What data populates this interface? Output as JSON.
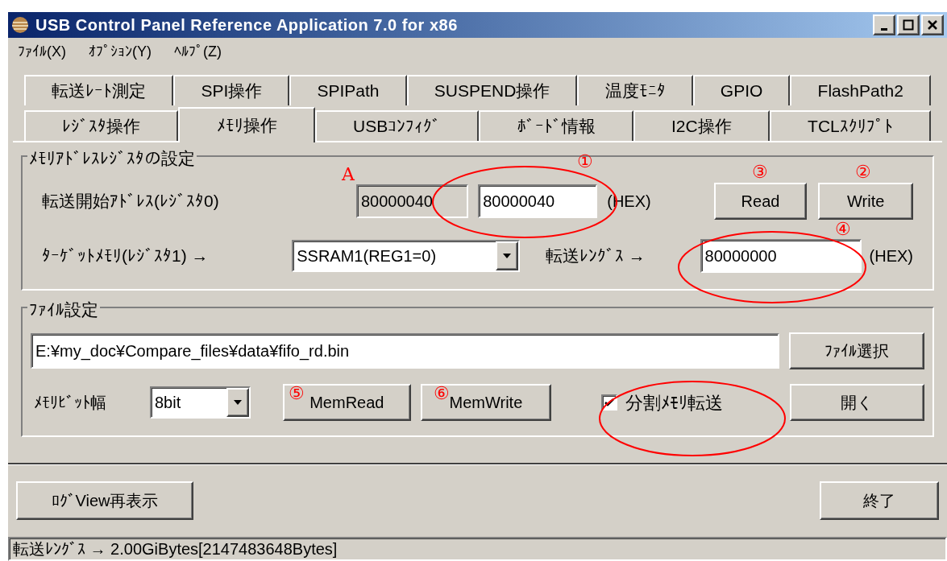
{
  "window": {
    "title": "USB Control Panel Reference Application 7.0 for x86"
  },
  "menu": [
    "ﾌｧｲﾙ(X)",
    "ｵﾌﾟｼｮﾝ(Y)",
    "ﾍﾙﾌﾟ(Z)"
  ],
  "tab_rows": [
    [
      {
        "label": "転送ﾚｰﾄ測定",
        "selected": false
      },
      {
        "label": "SPI操作",
        "selected": false
      },
      {
        "label": "SPIPath",
        "selected": false
      },
      {
        "label": "SUSPEND操作",
        "selected": false
      },
      {
        "label": "温度ﾓﾆﾀ",
        "selected": false
      },
      {
        "label": "GPIO",
        "selected": false
      },
      {
        "label": "FlashPath2",
        "selected": false
      }
    ],
    [
      {
        "label": "ﾚｼﾞｽﾀ操作",
        "selected": false
      },
      {
        "label": "ﾒﾓﾘ操作",
        "selected": true
      },
      {
        "label": "USBｺﾝﾌｨｸﾞ",
        "selected": false
      },
      {
        "label": "ﾎﾞｰﾄﾞ情報",
        "selected": false
      },
      {
        "label": "I2C操作",
        "selected": false
      },
      {
        "label": "TCLｽｸﾘﾌﾟﾄ",
        "selected": false
      }
    ]
  ],
  "address_group": {
    "title": "ﾒﾓﾘｱﾄﾞﾚｽﾚｼﾞｽﾀの設定",
    "start_address": {
      "label": "転送開始ｱﾄﾞﾚｽ(ﾚｼﾞｽﾀ0)",
      "current": "80000040",
      "value": "80000040",
      "unit": "(HEX)"
    },
    "buttons": [
      "Read",
      "Write"
    ],
    "target_memory": {
      "label": "ﾀｰｹﾞｯﾄﾒﾓﾘ(ﾚｼﾞｽﾀ1) →",
      "value": "SSRAM1(REG1=0)"
    },
    "length": {
      "label": "転送ﾚﾝｸﾞｽ →",
      "value": "80000000",
      "unit": "(HEX)"
    }
  },
  "file_group": {
    "title": "ﾌｧｲﾙ設定",
    "path": "E:¥my_doc¥Compare_files¥data¥fifo_rd.bin",
    "browse_button": "ﾌｧｲﾙ選択",
    "bit_width": {
      "label": "ﾒﾓﾘﾋﾞｯﾄ幅",
      "value": "8bit"
    },
    "buttons": [
      "MemRead",
      "MemWrite"
    ],
    "split_transfer": {
      "label": "分割ﾒﾓﾘ転送",
      "checked": true
    },
    "open_button": "開く"
  },
  "footer_buttons": [
    "ﾛｸﾞView再表示",
    "終了"
  ],
  "status_bar": "転送ﾚﾝｸﾞｽ → 2.00GiBytes[2147483648Bytes]",
  "annotations": [
    "A",
    "①",
    "③",
    "②",
    "④",
    "⑤",
    "⑥"
  ]
}
